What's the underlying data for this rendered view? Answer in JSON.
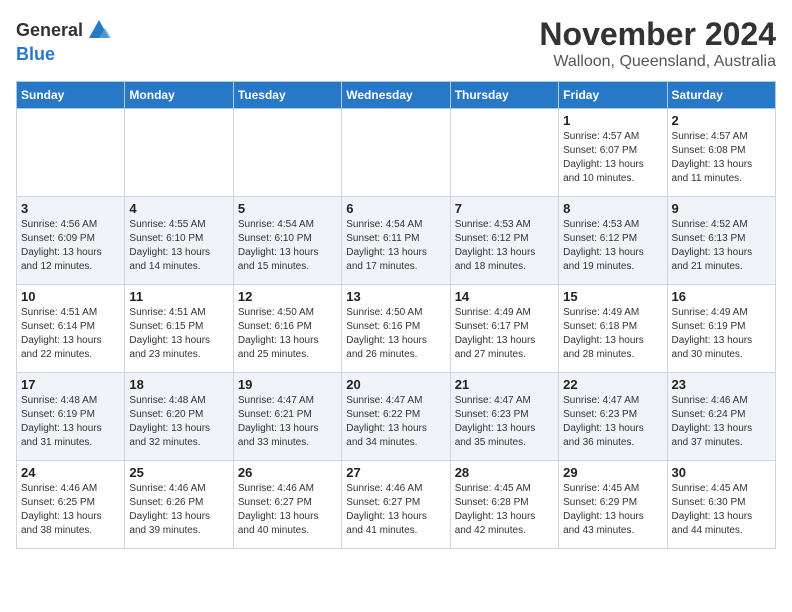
{
  "header": {
    "logo_general": "General",
    "logo_blue": "Blue",
    "month": "November 2024",
    "location": "Walloon, Queensland, Australia"
  },
  "calendar": {
    "days_of_week": [
      "Sunday",
      "Monday",
      "Tuesday",
      "Wednesday",
      "Thursday",
      "Friday",
      "Saturday"
    ],
    "weeks": [
      [
        {
          "day": "",
          "info": ""
        },
        {
          "day": "",
          "info": ""
        },
        {
          "day": "",
          "info": ""
        },
        {
          "day": "",
          "info": ""
        },
        {
          "day": "",
          "info": ""
        },
        {
          "day": "1",
          "info": "Sunrise: 4:57 AM\nSunset: 6:07 PM\nDaylight: 13 hours\nand 10 minutes."
        },
        {
          "day": "2",
          "info": "Sunrise: 4:57 AM\nSunset: 6:08 PM\nDaylight: 13 hours\nand 11 minutes."
        }
      ],
      [
        {
          "day": "3",
          "info": "Sunrise: 4:56 AM\nSunset: 6:09 PM\nDaylight: 13 hours\nand 12 minutes."
        },
        {
          "day": "4",
          "info": "Sunrise: 4:55 AM\nSunset: 6:10 PM\nDaylight: 13 hours\nand 14 minutes."
        },
        {
          "day": "5",
          "info": "Sunrise: 4:54 AM\nSunset: 6:10 PM\nDaylight: 13 hours\nand 15 minutes."
        },
        {
          "day": "6",
          "info": "Sunrise: 4:54 AM\nSunset: 6:11 PM\nDaylight: 13 hours\nand 17 minutes."
        },
        {
          "day": "7",
          "info": "Sunrise: 4:53 AM\nSunset: 6:12 PM\nDaylight: 13 hours\nand 18 minutes."
        },
        {
          "day": "8",
          "info": "Sunrise: 4:53 AM\nSunset: 6:12 PM\nDaylight: 13 hours\nand 19 minutes."
        },
        {
          "day": "9",
          "info": "Sunrise: 4:52 AM\nSunset: 6:13 PM\nDaylight: 13 hours\nand 21 minutes."
        }
      ],
      [
        {
          "day": "10",
          "info": "Sunrise: 4:51 AM\nSunset: 6:14 PM\nDaylight: 13 hours\nand 22 minutes."
        },
        {
          "day": "11",
          "info": "Sunrise: 4:51 AM\nSunset: 6:15 PM\nDaylight: 13 hours\nand 23 minutes."
        },
        {
          "day": "12",
          "info": "Sunrise: 4:50 AM\nSunset: 6:16 PM\nDaylight: 13 hours\nand 25 minutes."
        },
        {
          "day": "13",
          "info": "Sunrise: 4:50 AM\nSunset: 6:16 PM\nDaylight: 13 hours\nand 26 minutes."
        },
        {
          "day": "14",
          "info": "Sunrise: 4:49 AM\nSunset: 6:17 PM\nDaylight: 13 hours\nand 27 minutes."
        },
        {
          "day": "15",
          "info": "Sunrise: 4:49 AM\nSunset: 6:18 PM\nDaylight: 13 hours\nand 28 minutes."
        },
        {
          "day": "16",
          "info": "Sunrise: 4:49 AM\nSunset: 6:19 PM\nDaylight: 13 hours\nand 30 minutes."
        }
      ],
      [
        {
          "day": "17",
          "info": "Sunrise: 4:48 AM\nSunset: 6:19 PM\nDaylight: 13 hours\nand 31 minutes."
        },
        {
          "day": "18",
          "info": "Sunrise: 4:48 AM\nSunset: 6:20 PM\nDaylight: 13 hours\nand 32 minutes."
        },
        {
          "day": "19",
          "info": "Sunrise: 4:47 AM\nSunset: 6:21 PM\nDaylight: 13 hours\nand 33 minutes."
        },
        {
          "day": "20",
          "info": "Sunrise: 4:47 AM\nSunset: 6:22 PM\nDaylight: 13 hours\nand 34 minutes."
        },
        {
          "day": "21",
          "info": "Sunrise: 4:47 AM\nSunset: 6:23 PM\nDaylight: 13 hours\nand 35 minutes."
        },
        {
          "day": "22",
          "info": "Sunrise: 4:47 AM\nSunset: 6:23 PM\nDaylight: 13 hours\nand 36 minutes."
        },
        {
          "day": "23",
          "info": "Sunrise: 4:46 AM\nSunset: 6:24 PM\nDaylight: 13 hours\nand 37 minutes."
        }
      ],
      [
        {
          "day": "24",
          "info": "Sunrise: 4:46 AM\nSunset: 6:25 PM\nDaylight: 13 hours\nand 38 minutes."
        },
        {
          "day": "25",
          "info": "Sunrise: 4:46 AM\nSunset: 6:26 PM\nDaylight: 13 hours\nand 39 minutes."
        },
        {
          "day": "26",
          "info": "Sunrise: 4:46 AM\nSunset: 6:27 PM\nDaylight: 13 hours\nand 40 minutes."
        },
        {
          "day": "27",
          "info": "Sunrise: 4:46 AM\nSunset: 6:27 PM\nDaylight: 13 hours\nand 41 minutes."
        },
        {
          "day": "28",
          "info": "Sunrise: 4:45 AM\nSunset: 6:28 PM\nDaylight: 13 hours\nand 42 minutes."
        },
        {
          "day": "29",
          "info": "Sunrise: 4:45 AM\nSunset: 6:29 PM\nDaylight: 13 hours\nand 43 minutes."
        },
        {
          "day": "30",
          "info": "Sunrise: 4:45 AM\nSunset: 6:30 PM\nDaylight: 13 hours\nand 44 minutes."
        }
      ]
    ]
  }
}
